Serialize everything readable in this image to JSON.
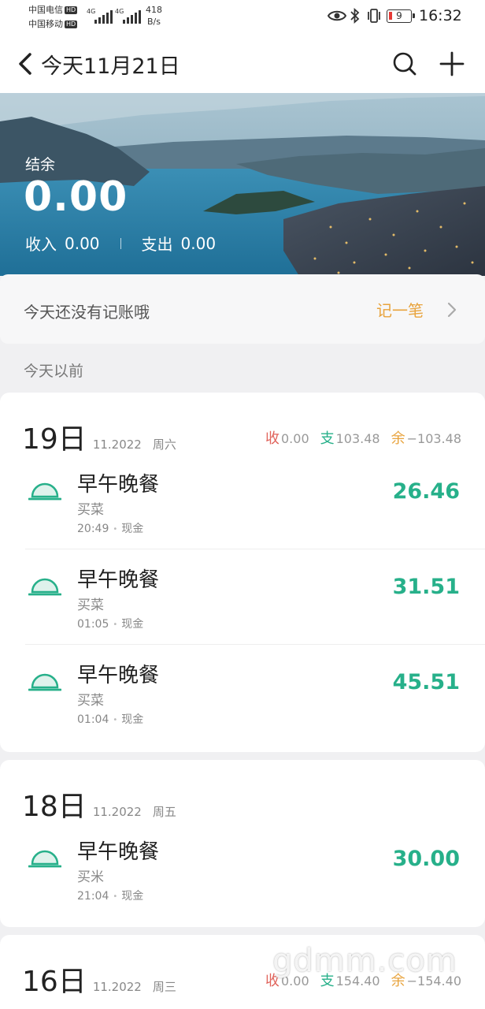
{
  "status_bar": {
    "carrier1": "中国电信",
    "carrier2": "中国移动",
    "hd": "HD",
    "network": "4G",
    "speed_value": "418",
    "speed_unit": "B/s",
    "battery": "9",
    "time": "16:32"
  },
  "header": {
    "title": "今天11月21日"
  },
  "summary": {
    "balance_label": "结余",
    "balance": "0.00",
    "income_label": "收入",
    "income": "0.00",
    "expense_label": "支出",
    "expense": "0.00"
  },
  "today": {
    "empty_text": "今天还没有记账哦",
    "record_label": "记一笔"
  },
  "section_label": "今天以前",
  "labels": {
    "in": "收",
    "out": "支",
    "bal": "余",
    "dot": "•"
  },
  "days": [
    {
      "day": "19日",
      "month": "11.2022",
      "weekday": "周六",
      "in": "0.00",
      "out": "103.48",
      "bal": "−103.48",
      "items": [
        {
          "category": "早午晚餐",
          "note": "买菜",
          "time": "20:49",
          "account": "现金",
          "amount": "26.46"
        },
        {
          "category": "早午晚餐",
          "note": "买菜",
          "time": "01:05",
          "account": "现金",
          "amount": "31.51"
        },
        {
          "category": "早午晚餐",
          "note": "买菜",
          "time": "01:04",
          "account": "现金",
          "amount": "45.51"
        }
      ]
    },
    {
      "day": "18日",
      "month": "11.2022",
      "weekday": "周五",
      "items": [
        {
          "category": "早午晚餐",
          "note": "买米",
          "time": "21:04",
          "account": "现金",
          "amount": "30.00"
        }
      ]
    },
    {
      "day": "16日",
      "month": "11.2022",
      "weekday": "周三",
      "in": "0.00",
      "out": "154.40",
      "bal": "−154.40"
    }
  ],
  "watermark": "gdmm.com",
  "icons": {
    "back": "chevron-left-icon",
    "search": "search-icon",
    "add": "plus-icon",
    "record_chevron": "chevron-right-icon",
    "meal": "food-cover-icon",
    "eye": "eye-icon",
    "bluetooth": "bluetooth-icon",
    "vibrate": "vibrate-icon"
  },
  "colors": {
    "income": "#e0625a",
    "expense": "#27b08a",
    "balance": "#e8a33c",
    "accent": "#27b08a"
  }
}
